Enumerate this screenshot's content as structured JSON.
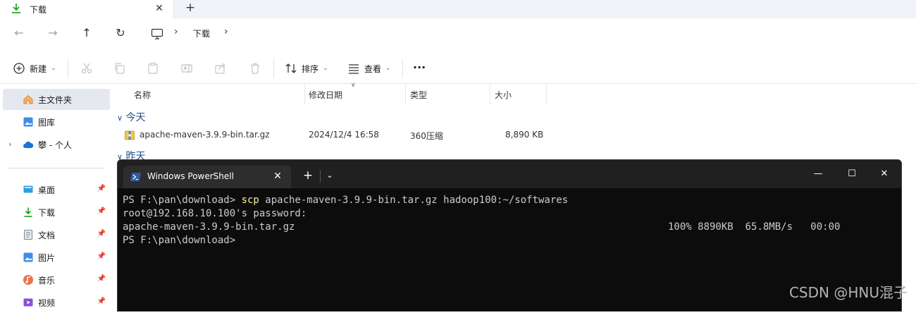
{
  "explorer": {
    "tab_title": "下载",
    "tab_close": "✕",
    "tab_add": "+",
    "nav": {
      "back": "←",
      "forward": "→",
      "up": "↑",
      "refresh": "↻"
    },
    "breadcrumb": {
      "sep": "›",
      "location": "下载"
    },
    "toolbar": {
      "new_label": "新建",
      "sort_label": "排序",
      "view_label": "查看",
      "more": "···",
      "chevron": "⌄"
    },
    "sidebar": {
      "home": "主文件夹",
      "gallery": "图库",
      "onedrive": "攀 - 个人",
      "quick": [
        {
          "label": "桌面",
          "pin": "📌"
        },
        {
          "label": "下载",
          "pin": "📌"
        },
        {
          "label": "文档",
          "pin": "📌"
        },
        {
          "label": "图片",
          "pin": "📌"
        },
        {
          "label": "音乐",
          "pin": "📌"
        },
        {
          "label": "视频",
          "pin": "📌"
        }
      ],
      "expander": "›"
    },
    "columns": {
      "name": "名称",
      "modified": "修改日期",
      "type": "类型",
      "size": "大小"
    },
    "groups": {
      "today": "今天",
      "yesterday": "昨天",
      "chevron": "∨"
    },
    "files": [
      {
        "name": "apache-maven-3.9.9-bin.tar.gz",
        "modified": "2024/12/4 16:58",
        "type": "360压缩",
        "size": "8,890 KB"
      }
    ]
  },
  "powershell": {
    "title": "Windows PowerShell",
    "close": "✕",
    "add": "+",
    "dropdown": "⌄",
    "minimize": "—",
    "maximize": "☐",
    "window_close": "✕",
    "lines": [
      {
        "prompt": "PS F:\\pan\\download> ",
        "cmd": "scp",
        "args": " apache-maven-3.9.9-bin.tar.gz hadoop100:~/softwares"
      },
      {
        "text": "root@192.168.10.100's password:"
      },
      {
        "text": "apache-maven-3.9.9-bin.tar.gz",
        "stats": "100% 8890KB  65.8MB/s   00:00"
      },
      {
        "text": "PS F:\\pan\\download>"
      }
    ]
  },
  "watermark": "CSDN @HNU混子",
  "colors": {
    "accent": "#0067c0",
    "terminal_bg": "#0c0c0c",
    "command_yellow": "#f9f1a5"
  }
}
